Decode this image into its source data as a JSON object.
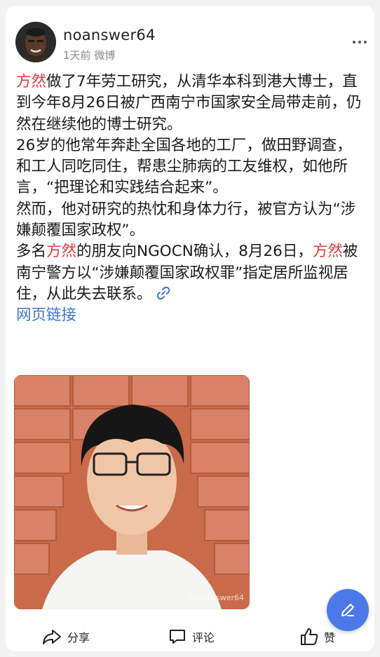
{
  "header": {
    "username": "noanswer64",
    "time": "1天前",
    "source": "微博"
  },
  "post": {
    "p1_name": "方然",
    "p1_text": "做了7年劳工研究，从清华本科到港大博士，直到今年8月26日被广西南宁市国家安全局带走前，仍然在继续他的博士研究。",
    "p2": "26岁的他常年奔赴全国各地的工厂，做田野调查，和工人同吃同住，帮患尘肺病的工友维权，如他所言，“把理论和实践结合起来”。",
    "p3": "然而，他对研究的热忱和身体力行，被官方认为“涉嫌颠覆国家政权”。",
    "p4_a": "多名",
    "p4_name1": "方然",
    "p4_b": "的朋友向NGOCN确认，8月26日，",
    "p4_name2": "方然",
    "p4_c": "被南宁警方以“涉嫌颠覆国家政权罪”指定居所监视居住，从此失去联系。",
    "link_label": "网页链接",
    "watermark": "@noanswer64"
  },
  "actions": {
    "share": "分享",
    "comment": "评论",
    "like": "赞"
  },
  "colors": {
    "name_highlight": "#e0383e",
    "link": "#3f77c9",
    "fab": "#4b79e8"
  },
  "icons": [
    "more-icon",
    "link-icon",
    "share-icon",
    "comment-icon",
    "like-icon",
    "edit-icon"
  ]
}
